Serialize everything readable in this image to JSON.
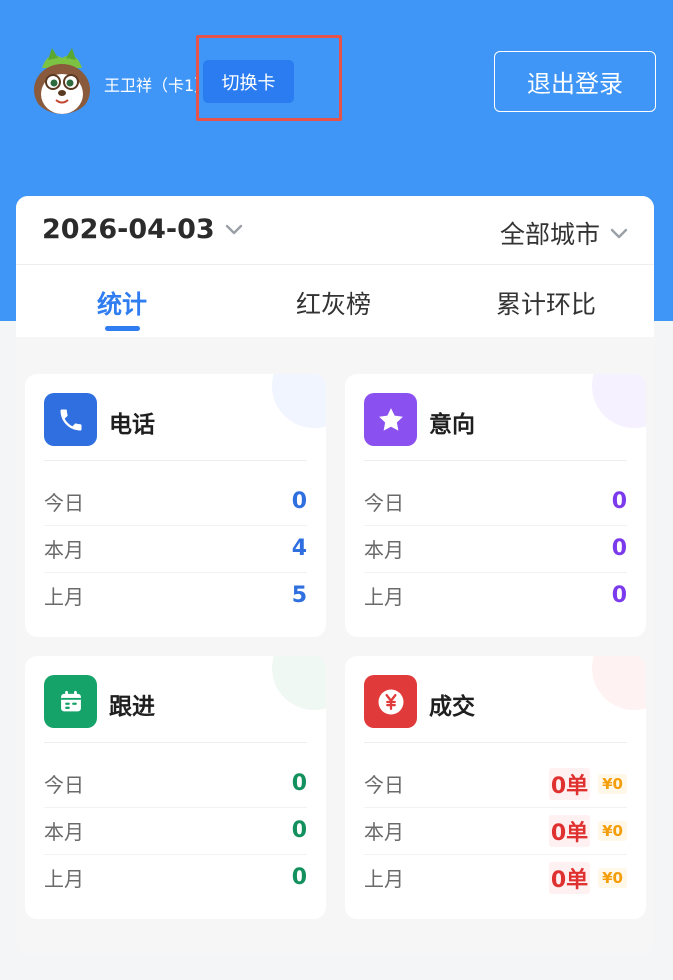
{
  "header": {
    "user_name": "王卫祥（卡1）",
    "switch_label": "切换卡",
    "logout_label": "退出登录"
  },
  "filters": {
    "date": "2026-04-03",
    "city": "全部城市"
  },
  "tabs": [
    {
      "label": "统计",
      "active": true
    },
    {
      "label": "红灰榜",
      "active": false
    },
    {
      "label": "累计环比",
      "active": false
    }
  ],
  "row_labels": {
    "today": "今日",
    "month": "本月",
    "last_month": "上月"
  },
  "cards": {
    "phone": {
      "title": "电话",
      "icon": "phone-icon",
      "color": "#2f6fe0",
      "today": "0",
      "month": "4",
      "last_month": "5"
    },
    "intent": {
      "title": "意向",
      "icon": "star-icon",
      "color": "#7c3aed",
      "today": "0",
      "month": "0",
      "last_month": "0"
    },
    "followup": {
      "title": "跟进",
      "icon": "calendar-icon",
      "color": "#12915e",
      "today": "0",
      "month": "0",
      "last_month": "0"
    },
    "deal": {
      "title": "成交",
      "icon": "yen-icon",
      "color": "#e03131",
      "today": "0单",
      "today_amount": "¥0",
      "month": "0单",
      "month_amount": "¥0",
      "last_month": "0单",
      "last_month_amount": "¥0"
    }
  }
}
